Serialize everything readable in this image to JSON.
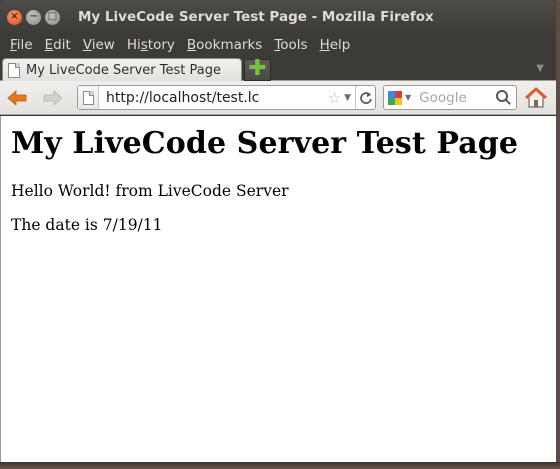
{
  "window": {
    "title": "My LiveCode Server Test Page - Mozilla Firefox",
    "controls": [
      "close-icon",
      "minimize-icon",
      "maximize-icon"
    ]
  },
  "menubar": {
    "items": [
      {
        "label_acc": "F",
        "label_rest": "ile"
      },
      {
        "label_acc": "E",
        "label_rest": "dit"
      },
      {
        "label_acc": "V",
        "label_rest": "iew"
      },
      {
        "label_pre": "Hi",
        "label_acc": "s",
        "label_rest": "tory"
      },
      {
        "label_acc": "B",
        "label_rest": "ookmarks"
      },
      {
        "label_acc": "T",
        "label_rest": "ools"
      },
      {
        "label_acc": "H",
        "label_rest": "elp"
      }
    ]
  },
  "tabs": [
    {
      "label": "My LiveCode Server Test Page",
      "active": true
    }
  ],
  "navbar": {
    "url": "http://localhost/test.lc",
    "search_placeholder": "Google",
    "search_engine_icon": "google-icon"
  },
  "page": {
    "heading": "My LiveCode Server Test Page",
    "line1": "Hello World! from LiveCode Server",
    "line2": "The date is 7/19/11"
  },
  "colors": {
    "titlebar": "#3c3b37",
    "back_arrow": "#e87a1d",
    "home_roof": "#e05a2b",
    "new_tab_plus": "#76c043"
  }
}
